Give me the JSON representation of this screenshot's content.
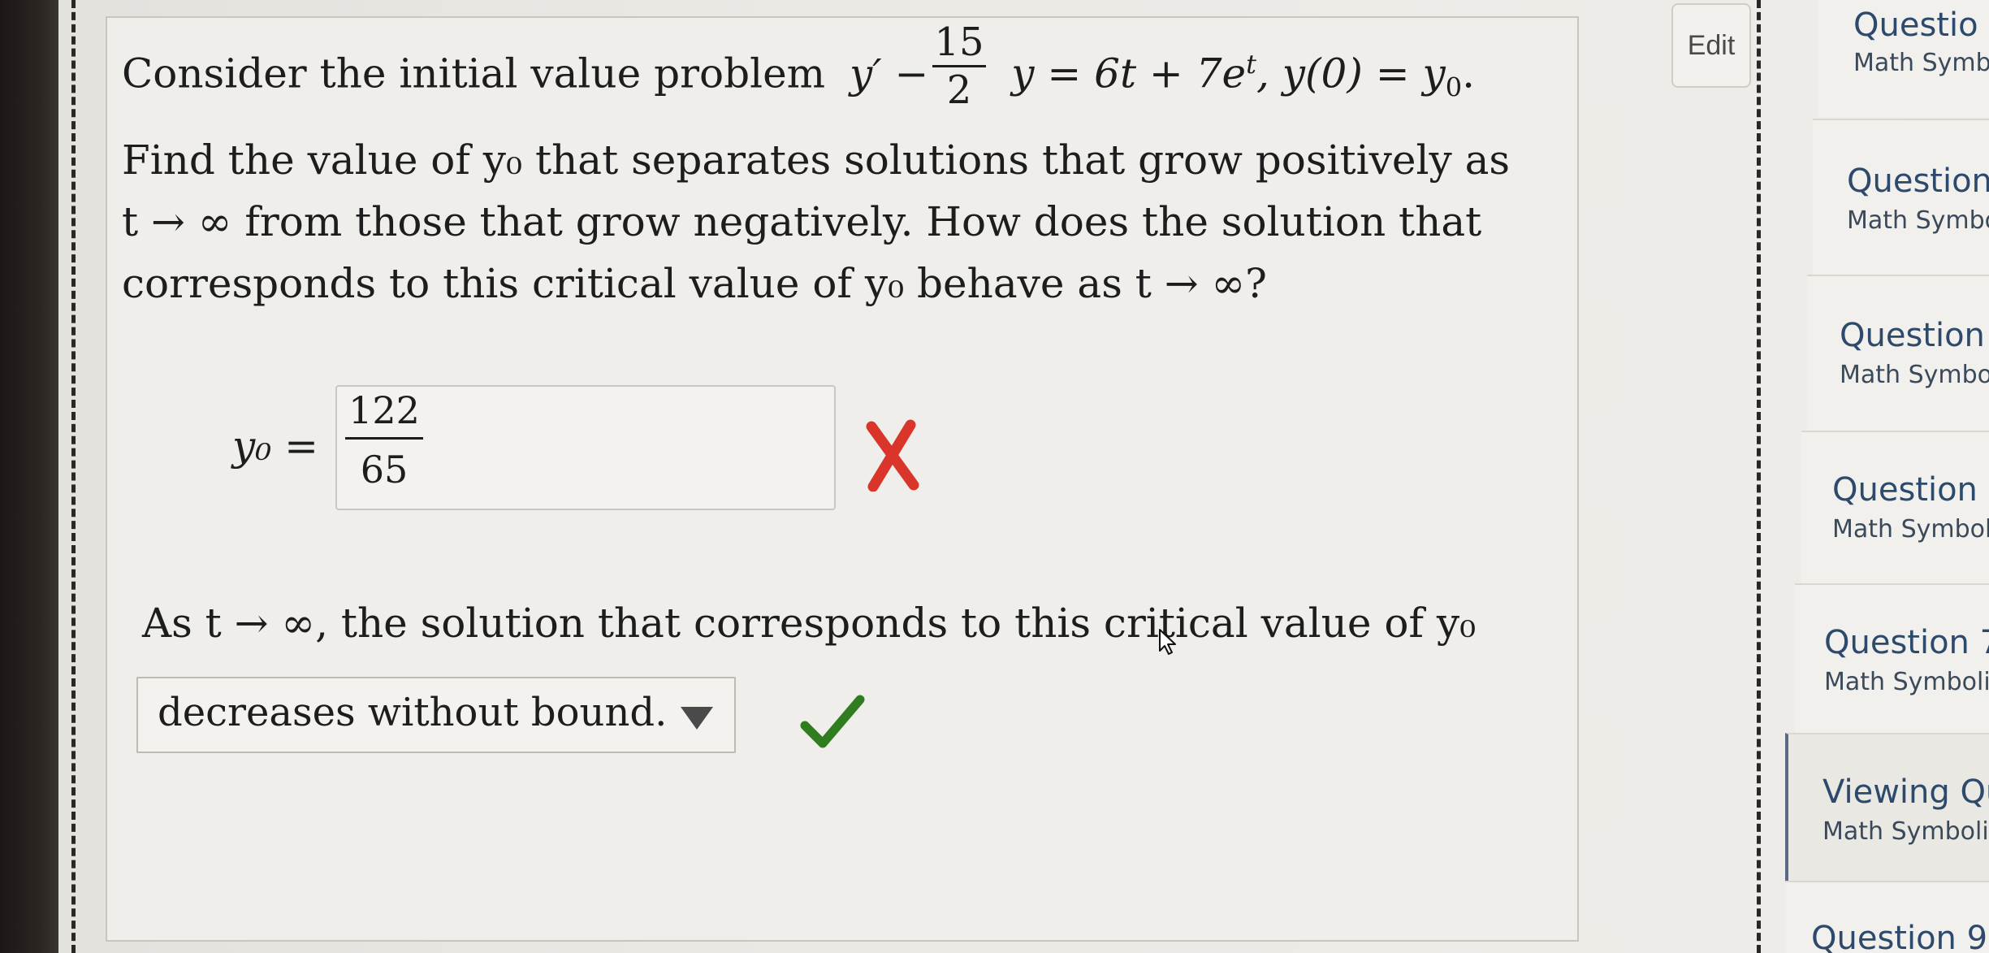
{
  "question": {
    "line1_prefix": "Consider the initial value problem",
    "eq_y_prime": "y′ −",
    "eq_frac_num": "15",
    "eq_frac_den": "2",
    "eq_rest": "y = 6t + 7e",
    "eq_exp": "t",
    "eq_end": ", y(0) = y",
    "eq_sub": "0",
    "eq_period": ".",
    "para_line1": "Find the value of y₀ that separates solutions that grow positively as",
    "para_line2": "t → ∞ from those that grow negatively. How does the solution that",
    "para_line3": "corresponds to this critical value of y₀ behave as t → ∞?"
  },
  "answer1": {
    "label": "y₀ =",
    "num": "122",
    "den": "65",
    "status": "incorrect"
  },
  "part2": {
    "prompt": "As t → ∞, the solution that corresponds to this critical value of y₀",
    "dropdown_value": "decreases without bound.",
    "status": "correct"
  },
  "toolbar": {
    "edit_label": "Edit"
  },
  "sidebar": {
    "items": [
      {
        "title": "Questio",
        "subtitle": "Math Symb"
      },
      {
        "title": "Question",
        "subtitle": "Math Symbo"
      },
      {
        "title": "Question",
        "subtitle": "Math Symbol"
      },
      {
        "title": "Question",
        "subtitle": "Math Symboli"
      },
      {
        "title": "Question 7",
        "subtitle": "Math Symbolic"
      },
      {
        "title": "Viewing Qu",
        "subtitle": "Math Symbolic"
      },
      {
        "title": "Question 9",
        "subtitle": ""
      }
    ]
  },
  "colors": {
    "incorrect": "#d9352b",
    "correct": "#2f7d1f",
    "link": "#2d4a6c"
  }
}
